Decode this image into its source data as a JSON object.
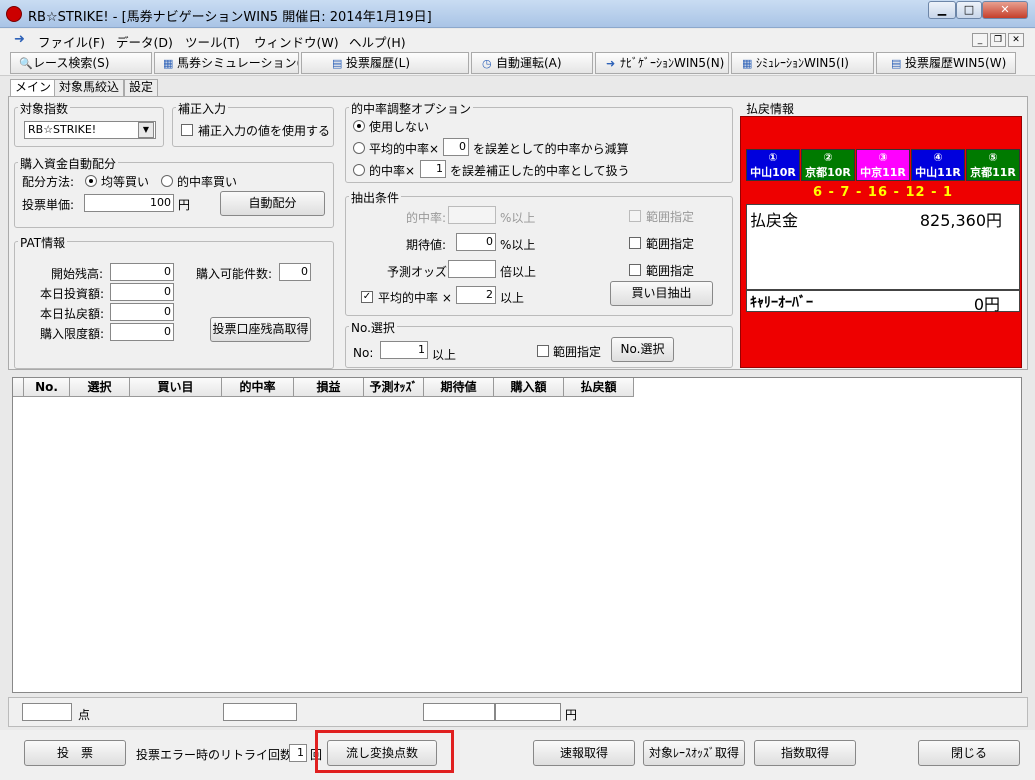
{
  "window": {
    "title": "RB☆STRIKE! - [馬券ナビゲーションWIN5  開催日: 2014年1月19日]",
    "minimize": "▁",
    "maximize": "□",
    "close": "✕"
  },
  "menu": [
    "ファイル(F)",
    "データ(D)",
    "ツール(T)",
    "ウィンドウ(W)",
    "ヘルプ(H)"
  ],
  "toolbar": [
    "レース検索(S)",
    "馬券シミュレーション(B)",
    "投票履歴(L)",
    "自動運転(A)",
    "ﾅﾋﾞｹﾞｰｼｮﾝWIN5(N)",
    "ｼﾐｭﾚｰｼｮﾝWIN5(I)",
    "投票履歴WIN5(W)"
  ],
  "tabs": [
    "メイン",
    "対象馬絞込",
    "設定"
  ],
  "target_index": {
    "title": "対象指数",
    "selected": "RB☆STRIKE!"
  },
  "correction": {
    "title": "補正入力",
    "checkbox_label": "補正入力の値を使用する"
  },
  "auto_fund": {
    "title": "購入資金自動配分",
    "method_label": "配分方法:",
    "opt_equal": "均等買い",
    "opt_hit": "的中率買い",
    "unit_label": "投票単価:",
    "unit_value": "100",
    "unit_suffix": "円",
    "button": "自動配分"
  },
  "pat": {
    "title": "PAT情報",
    "start_balance_label": "開始残高:",
    "start_balance": "0",
    "today_bet_label": "本日投資額:",
    "today_bet": "0",
    "today_refund_label": "本日払戻額:",
    "today_refund": "0",
    "limit_label": "購入限度額:",
    "limit": "0",
    "count_label": "購入可能件数:",
    "count": "0",
    "button": "投票口座残高取得"
  },
  "hit_option": {
    "title": "的中率調整オプション",
    "opt_none": "使用しない",
    "opt_avg_prefix": "平均的中率×",
    "opt_avg_value": "0",
    "opt_avg_suffix": "を誤差として的中率から減算",
    "opt_rate_prefix": "的中率×",
    "opt_rate_value": "1",
    "opt_rate_suffix": "を誤差補正した的中率として扱う"
  },
  "extract": {
    "title": "抽出条件",
    "hit_label": "的中率:",
    "hit_suffix": "%以上",
    "hit_range": "範囲指定",
    "exp_label": "期待値:",
    "exp_value": "0",
    "exp_suffix": "%以上",
    "exp_range": "範囲指定",
    "odds_label": "予測オッズ:",
    "odds_suffix": "倍以上",
    "odds_range": "範囲指定",
    "avg_label": "平均的中率 ×",
    "avg_value": "2",
    "avg_suffix": "以上",
    "avg_checked": "✓",
    "button": "買い目抽出"
  },
  "no_select": {
    "title": "No.選択",
    "no_label": "No:",
    "no_value": "1",
    "no_suffix": "以上",
    "range": "範囲指定",
    "button": "No.選択"
  },
  "payout": {
    "title": "払戻情報",
    "races": [
      {
        "num": "①",
        "name": "中山10R",
        "color": "#0000dd"
      },
      {
        "num": "②",
        "name": "京都10R",
        "color": "#007a00"
      },
      {
        "num": "③",
        "name": "中京11R",
        "color": "#ff00ff"
      },
      {
        "num": "④",
        "name": "中山11R",
        "color": "#0000dd"
      },
      {
        "num": "⑤",
        "name": "京都11R",
        "color": "#007a00"
      }
    ],
    "result": "6 - 7 - 16 - 12 - 1",
    "payout_label": "払戻金",
    "payout_value": "825,360円",
    "carry_label": "ｷｬﾘｰｵｰﾊﾞｰ",
    "carry_value": "0円"
  },
  "grid": {
    "columns": [
      "No.",
      "選択",
      "買い目",
      "的中率",
      "損益",
      "予測ｵｯｽﾞ",
      "期待値",
      "購入額",
      "払戻額"
    ]
  },
  "summary": {
    "points_suffix": "点",
    "yen_suffix": "円"
  },
  "footer": {
    "vote": "投　票",
    "retry_label": "投票エラー時のリトライ回数:",
    "retry_value": "1",
    "retry_suffix": "回",
    "flow_convert": "流し変換点数",
    "odds_fetch": "速報取得",
    "target_odds": "対象ﾚｰｽｵｯｽﾞ取得",
    "index_fetch": "指数取得",
    "close": "閉じる"
  }
}
